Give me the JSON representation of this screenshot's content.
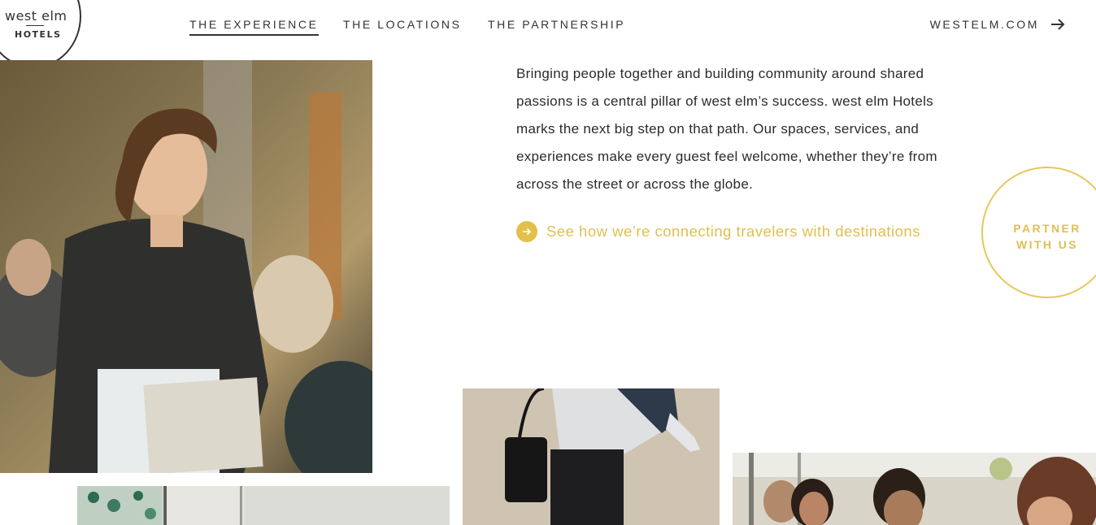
{
  "logo": {
    "line1": "west elm",
    "line2": "HOTELS"
  },
  "nav": {
    "links": [
      {
        "label": "THE EXPERIENCE",
        "active": true
      },
      {
        "label": "THE LOCATIONS",
        "active": false
      },
      {
        "label": "THE PARTNERSHIP",
        "active": false
      }
    ],
    "external": {
      "label": "WESTELM.COM",
      "icon": "arrow-right-icon"
    }
  },
  "intro": {
    "paragraph": "Bringing people together and building community around shared passions is a central pillar of west elm’s success. west elm Hotels marks the next big step on that path. Our spaces, services, and experiences make every guest feel welcome, whether they’re from across the street or across the globe.",
    "cta": {
      "label": "See how we’re connecting travelers with destinations",
      "icon": "arrow-right-circle-icon"
    }
  },
  "partner_badge": {
    "label": "PARTNER\nWITH US"
  },
  "colors": {
    "accent": "#e0bf51",
    "text": "#2b2b2b",
    "background": "#ffffff"
  },
  "images": [
    {
      "name": "waitress-photo",
      "description_icon": "photo"
    },
    {
      "name": "traveler-walking-photo",
      "description_icon": "photo"
    },
    {
      "name": "restaurant-interior-photo",
      "description_icon": "photo"
    },
    {
      "name": "group-dining-photo",
      "description_icon": "photo"
    }
  ]
}
